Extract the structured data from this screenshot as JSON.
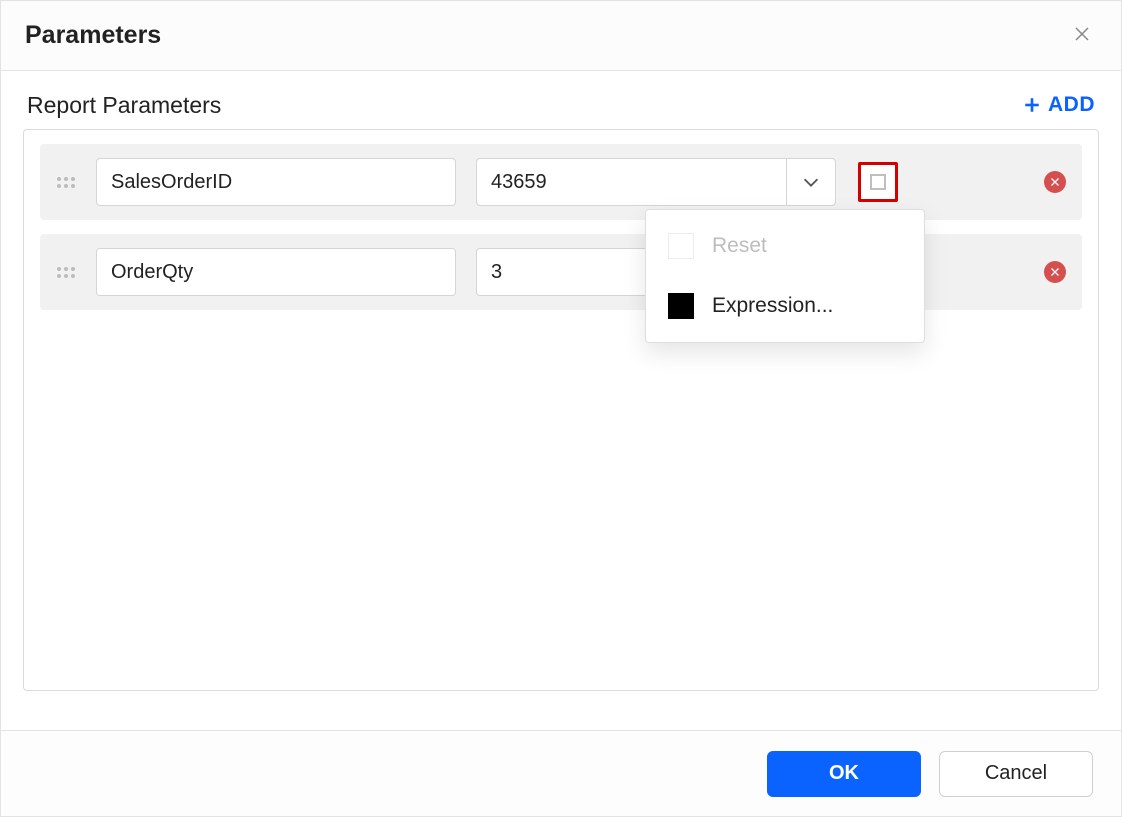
{
  "dialog": {
    "title": "Parameters"
  },
  "section": {
    "title": "Report Parameters",
    "add_label": "ADD"
  },
  "params": [
    {
      "name": "SalesOrderID",
      "value": "43659"
    },
    {
      "name": "OrderQty",
      "value": "3"
    }
  ],
  "popup": {
    "reset_label": "Reset",
    "expression_label": "Expression..."
  },
  "footer": {
    "ok_label": "OK",
    "cancel_label": "Cancel"
  }
}
